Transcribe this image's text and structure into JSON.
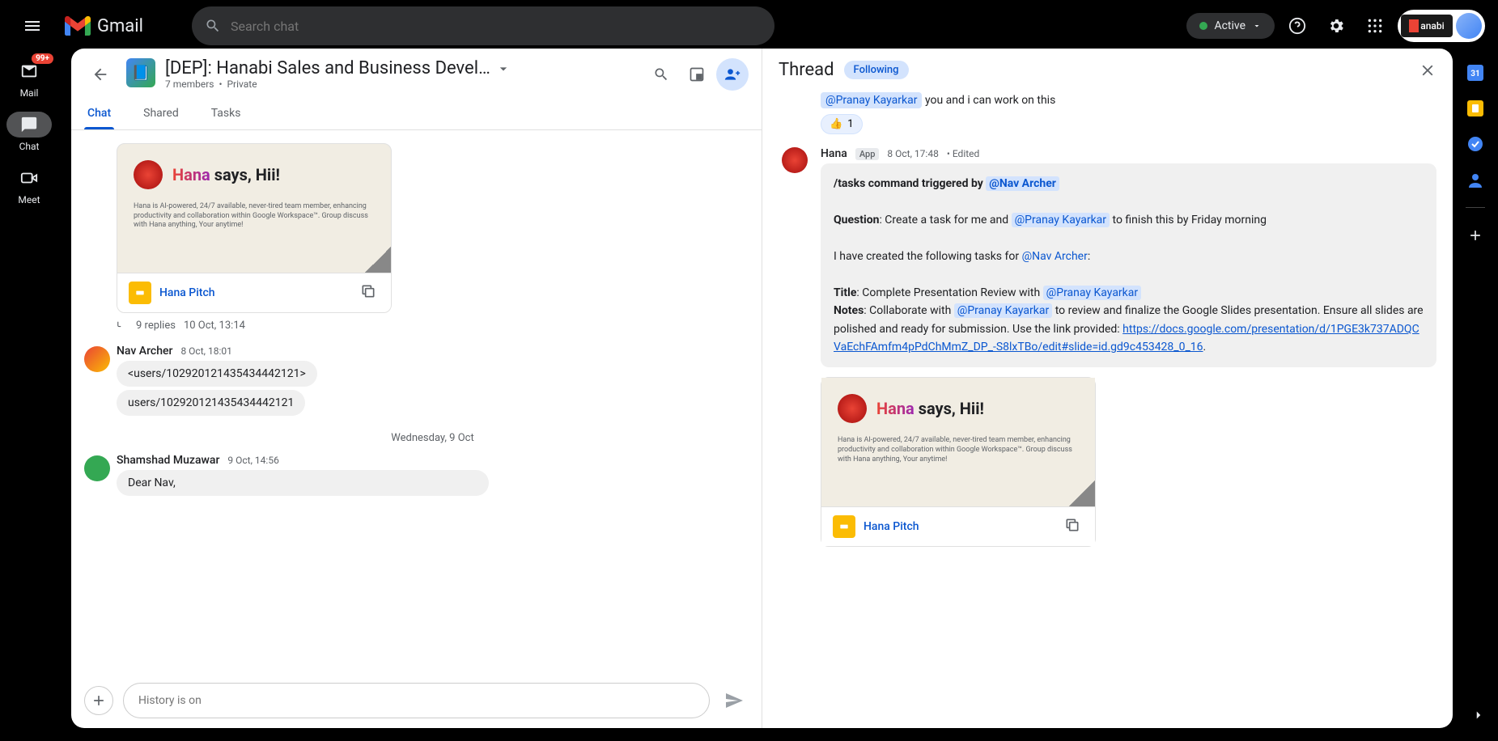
{
  "topbar": {
    "app_name": "Gmail",
    "search_placeholder": "Search chat",
    "active_label": "Active",
    "org_label": "anabi"
  },
  "nav": {
    "mail": {
      "label": "Mail",
      "badge": "99+"
    },
    "chat": {
      "label": "Chat"
    },
    "meet": {
      "label": "Meet"
    }
  },
  "room": {
    "title": "[DEP]: Hanabi Sales and Business Devel…",
    "members_count": "7 members",
    "privacy": "Private"
  },
  "tabs": {
    "chat": "Chat",
    "shared": "Shared",
    "tasks": "Tasks"
  },
  "hana_card": {
    "name": "Hana",
    "says": " says, Hii!",
    "desc": "Hana is  AI-powered, 24/7 available, never-tired team member, enhancing productivity and collaboration within Google Workspace™. Group discuss with Hana anything, Your anytime!",
    "link_label": "Hana Pitch"
  },
  "messages": {
    "replies": {
      "count": "9 replies",
      "time": "10 Oct, 13:14"
    },
    "nav_archer": {
      "name": "Nav Archer",
      "time": "8 Oct, 18:01",
      "line1": "<users/102920121435434442121>",
      "line2": "users/102920121435434442121"
    },
    "date_separator": "Wednesday, 9 Oct",
    "shamshad": {
      "name": "Shamshad Muzawar",
      "time": "9 Oct, 14:56",
      "text": "Dear Nav,"
    }
  },
  "compose": {
    "placeholder": "History is on"
  },
  "thread": {
    "title": "Thread",
    "following": "Following",
    "first_line": {
      "mention": "@Pranay Kayarkar",
      "text": "  you and i can work on this"
    },
    "reaction": {
      "emoji": "👍",
      "count": "1"
    },
    "hana_header": {
      "name": "Hana",
      "badge": "App",
      "time": "8 Oct, 17:48",
      "edited": "Edited"
    },
    "body": {
      "trigger_prefix": "/tasks command triggered by ",
      "trigger_mention": "@Nav Archer",
      "question_label": "Question",
      "question_text": ": Create a task for me and ",
      "question_mention": "@Pranay Kayarkar",
      "question_suffix": " to finish this by Friday morning",
      "created_prefix": "I have created the following tasks for ",
      "created_mention": "@Nav Archer",
      "created_suffix": ":",
      "title_label": "Title",
      "title_text": ": Complete Presentation Review with ",
      "title_mention": "@Pranay Kayarkar",
      "notes_label": "Notes",
      "notes_text": ": Collaborate with ",
      "notes_mention": "@Pranay Kayarkar",
      "notes_suffix": " to review and finalize the Google Slides presentation. Ensure all slides are polished and ready for submission. Use the link provided: ",
      "link": "https://docs.google.com/presentation/d/1PGE3k737ADQCVaEchFAmfm4pPdChMmZ_DP_-S8lxTBo/edit#slide=id.gd9c453428_0_16",
      "period": "."
    }
  },
  "side_rail": {
    "calendar_day": "31"
  }
}
